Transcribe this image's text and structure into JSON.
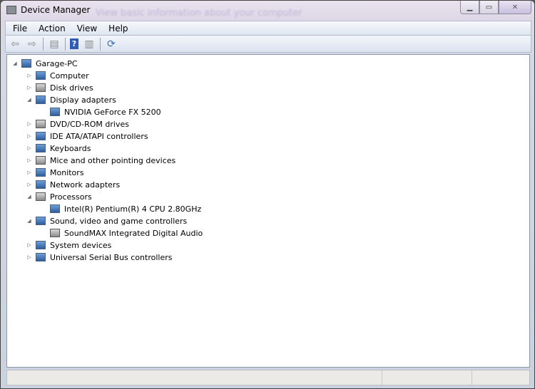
{
  "window": {
    "title": "Device Manager",
    "background_text": "View basic information about your computer"
  },
  "menu": [
    "File",
    "Action",
    "View",
    "Help"
  ],
  "toolbar": [
    "back-icon",
    "forward-icon",
    "show-hide-console-tree-icon",
    "help-icon",
    "show-action-pane-icon",
    "scan-hardware-icon"
  ],
  "tree": [
    {
      "label": "Garage-PC",
      "level": 0,
      "state": "expanded"
    },
    {
      "label": "Computer",
      "level": 1,
      "state": "collapsed"
    },
    {
      "label": "Disk drives",
      "level": 1,
      "state": "collapsed"
    },
    {
      "label": "Display adapters",
      "level": 1,
      "state": "expanded"
    },
    {
      "label": "NVIDIA GeForce FX 5200",
      "level": 2,
      "state": "leaf"
    },
    {
      "label": "DVD/CD-ROM drives",
      "level": 1,
      "state": "collapsed"
    },
    {
      "label": "IDE ATA/ATAPI controllers",
      "level": 1,
      "state": "collapsed"
    },
    {
      "label": "Keyboards",
      "level": 1,
      "state": "collapsed"
    },
    {
      "label": "Mice and other pointing devices",
      "level": 1,
      "state": "collapsed"
    },
    {
      "label": "Monitors",
      "level": 1,
      "state": "collapsed"
    },
    {
      "label": "Network adapters",
      "level": 1,
      "state": "collapsed"
    },
    {
      "label": "Processors",
      "level": 1,
      "state": "expanded"
    },
    {
      "label": "Intel(R) Pentium(R) 4 CPU 2.80GHz",
      "level": 2,
      "state": "leaf"
    },
    {
      "label": "Sound, video and game controllers",
      "level": 1,
      "state": "expanded"
    },
    {
      "label": "SoundMAX Integrated Digital Audio",
      "level": 2,
      "state": "leaf"
    },
    {
      "label": "System devices",
      "level": 1,
      "state": "collapsed"
    },
    {
      "label": "Universal Serial Bus controllers",
      "level": 1,
      "state": "collapsed"
    }
  ]
}
